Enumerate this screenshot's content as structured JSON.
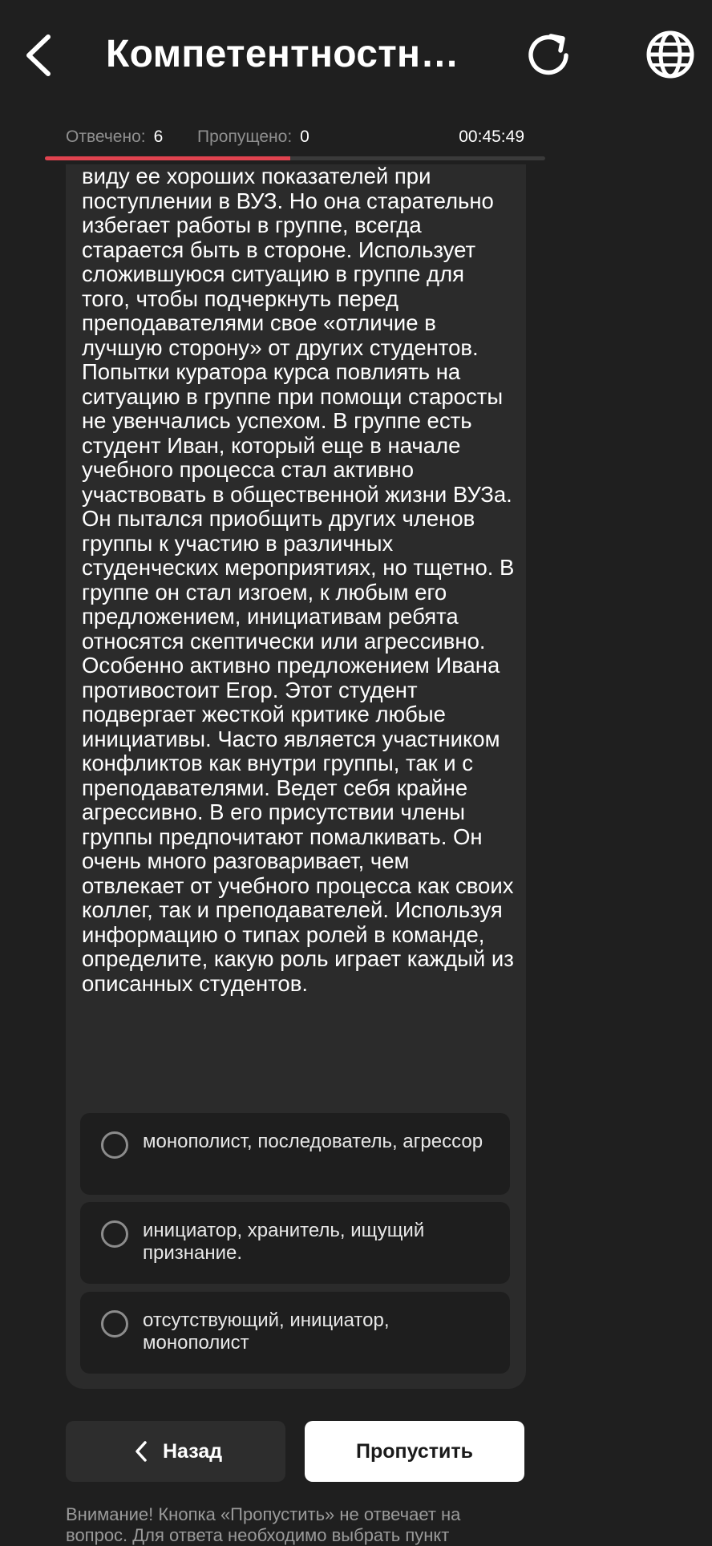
{
  "header": {
    "title": "Компетентностны...",
    "icons": [
      "back-arrow-icon",
      "refresh-icon",
      "globe-icon"
    ]
  },
  "status": {
    "answered_label": "Отвечено:",
    "answered_value": "6",
    "skipped_label": "Пропущено:",
    "skipped_value": "0",
    "timer": "00:45:49"
  },
  "progress": {
    "fraction": 0.49,
    "fill_color": "#e0434f"
  },
  "question": {
    "text": "виду ее хороших показателей при поступлении в ВУЗ. Но она старательно избегает работы в группе, всегда старается быть в стороне. Использует сложившуюся ситуацию в группе для того, чтобы подчеркнуть перед преподавателями свое «отличие в лучшую сторону» от других студентов. Попытки куратора курса повлиять на ситуацию в группе при помощи старосты не увенчались успехом. В группе есть студент Иван, который еще в начале учебного процесса стал активно участвовать в общественной жизни ВУЗа. Он пытался приобщить других членов группы к участию в различных студенческих мероприятиях, но тщетно. В группе он стал изгоем, к любым его предложением, инициативам ребята относятся скептически или агрессивно. Особенно активно предложением Ивана противостоит Егор. Этот студент подвергает жесткой критике любые инициативы. Часто является участником конфликтов как внутри группы, так и с преподавателями. Ведет себя крайне агрессивно. В его присутствии члены группы предпочитают помалкивать. Он очень много разговаривает, чем отвлекает от учебного процесса как своих коллег, так и преподавателей. Используя информацию о типах ролей в команде, определите, какую роль играет каждый из описанных студентов.",
    "options": [
      {
        "label": "монополист, последователь, агрессор"
      },
      {
        "label": "инициатор, хранитель, ищущий признание."
      },
      {
        "label": "отсутствующий, инициатор, монополист"
      }
    ]
  },
  "actions": {
    "back_label": "Назад",
    "skip_label": "Пропустить"
  },
  "notice": "Внимание! Кнопка «Пропустить» не отвечает на вопрос. Для ответа необходимо выбрать пункт"
}
